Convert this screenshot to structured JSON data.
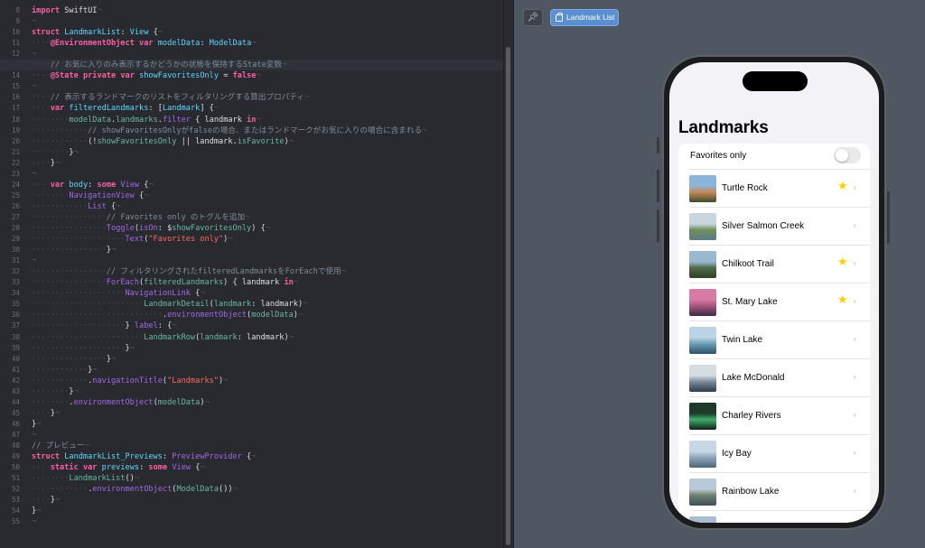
{
  "editor": {
    "current_line": 13,
    "lines": [
      {
        "n": 8,
        "tokens": [
          [
            "kw",
            "import"
          ],
          [
            "pl",
            " SwiftUI"
          ],
          [
            "ws",
            "¬"
          ]
        ]
      },
      {
        "n": 9,
        "tokens": [
          [
            "ws",
            "¬"
          ]
        ]
      },
      {
        "n": 10,
        "tokens": [
          [
            "kw",
            "struct"
          ],
          [
            "pl",
            " "
          ],
          [
            "ty",
            "LandmarkList"
          ],
          [
            "pl",
            ": "
          ],
          [
            "ty",
            "View"
          ],
          [
            "pl",
            " {"
          ],
          [
            "ws",
            "¬"
          ]
        ]
      },
      {
        "n": 11,
        "tokens": [
          [
            "ws",
            "····"
          ],
          [
            "kw",
            "@EnvironmentObject"
          ],
          [
            "pl",
            " "
          ],
          [
            "kw",
            "var"
          ],
          [
            "pl",
            " "
          ],
          [
            "ty",
            "modelData"
          ],
          [
            "pl",
            ": "
          ],
          [
            "ty",
            "ModelData"
          ],
          [
            "ws",
            "¬"
          ]
        ]
      },
      {
        "n": 12,
        "tokens": [
          [
            "ws",
            "¬"
          ]
        ]
      },
      {
        "n": 13,
        "tokens": [
          [
            "ws",
            "····"
          ],
          [
            "cm",
            "// お気に入りのみ表示するかどうかの状態を保持するState変数"
          ],
          [
            "ws",
            "¬"
          ]
        ]
      },
      {
        "n": 14,
        "tokens": [
          [
            "ws",
            "····"
          ],
          [
            "kw",
            "@State"
          ],
          [
            "pl",
            " "
          ],
          [
            "kw",
            "private"
          ],
          [
            "pl",
            " "
          ],
          [
            "kw",
            "var"
          ],
          [
            "pl",
            " "
          ],
          [
            "ty",
            "showFavoritesOnly"
          ],
          [
            "pl",
            " = "
          ],
          [
            "kw",
            "false"
          ],
          [
            "ws",
            "¬"
          ]
        ]
      },
      {
        "n": 15,
        "tokens": [
          [
            "ws",
            "¬"
          ]
        ]
      },
      {
        "n": 16,
        "tokens": [
          [
            "ws",
            "····"
          ],
          [
            "cm",
            "// 表示するランドマークのリストをフィルタリングする算出プロパティ"
          ],
          [
            "ws",
            "¬"
          ]
        ]
      },
      {
        "n": 17,
        "tokens": [
          [
            "ws",
            "····"
          ],
          [
            "kw",
            "var"
          ],
          [
            "pl",
            " "
          ],
          [
            "ty",
            "filteredLandmarks"
          ],
          [
            "pl",
            ": ["
          ],
          [
            "ty",
            "Landmark"
          ],
          [
            "pl",
            "] {"
          ],
          [
            "ws",
            "¬"
          ]
        ]
      },
      {
        "n": 18,
        "tokens": [
          [
            "ws",
            "········"
          ],
          [
            "fn",
            "modelData"
          ],
          [
            "pl",
            "."
          ],
          [
            "fn",
            "landmarks"
          ],
          [
            "pl",
            "."
          ],
          [
            "pr",
            "filter"
          ],
          [
            "pl",
            " { landmark "
          ],
          [
            "kw",
            "in"
          ],
          [
            "ws",
            "¬"
          ]
        ]
      },
      {
        "n": 19,
        "tokens": [
          [
            "ws",
            "············"
          ],
          [
            "cm",
            "// showFavoritesOnlyがfalseの場合、またはランドマークがお気に入りの場合に含まれる"
          ],
          [
            "ws",
            "¬"
          ]
        ]
      },
      {
        "n": 20,
        "tokens": [
          [
            "ws",
            "············"
          ],
          [
            "pl",
            "(!"
          ],
          [
            "fn",
            "showFavoritesOnly"
          ],
          [
            "pl",
            " || landmark."
          ],
          [
            "fn",
            "isFavorite"
          ],
          [
            "pl",
            ")"
          ],
          [
            "ws",
            "¬"
          ]
        ]
      },
      {
        "n": 21,
        "tokens": [
          [
            "ws",
            "········"
          ],
          [
            "pl",
            "}"
          ],
          [
            "ws",
            "¬"
          ]
        ]
      },
      {
        "n": 22,
        "tokens": [
          [
            "ws",
            "····"
          ],
          [
            "pl",
            "}"
          ],
          [
            "ws",
            "¬"
          ]
        ]
      },
      {
        "n": 23,
        "tokens": [
          [
            "ws",
            "¬"
          ]
        ]
      },
      {
        "n": 24,
        "tokens": [
          [
            "ws",
            "····"
          ],
          [
            "kw",
            "var"
          ],
          [
            "pl",
            " "
          ],
          [
            "ty",
            "body"
          ],
          [
            "pl",
            ": "
          ],
          [
            "kw",
            "some"
          ],
          [
            "pl",
            " "
          ],
          [
            "pr",
            "View"
          ],
          [
            "pl",
            " {"
          ],
          [
            "ws",
            "¬"
          ]
        ]
      },
      {
        "n": 25,
        "tokens": [
          [
            "ws",
            "········"
          ],
          [
            "pr",
            "NavigationView"
          ],
          [
            "pl",
            " {"
          ],
          [
            "ws",
            "¬"
          ]
        ]
      },
      {
        "n": 26,
        "tokens": [
          [
            "ws",
            "············"
          ],
          [
            "pr",
            "List"
          ],
          [
            "pl",
            " {"
          ],
          [
            "ws",
            "¬"
          ]
        ]
      },
      {
        "n": 27,
        "tokens": [
          [
            "ws",
            "················"
          ],
          [
            "cm",
            "// Favorites only のトグルを追加"
          ],
          [
            "ws",
            "¬"
          ]
        ]
      },
      {
        "n": 28,
        "tokens": [
          [
            "ws",
            "················"
          ],
          [
            "pr",
            "Toggle"
          ],
          [
            "pl",
            "("
          ],
          [
            "pr",
            "isOn"
          ],
          [
            "pl",
            ": $"
          ],
          [
            "fn",
            "showFavoritesOnly"
          ],
          [
            "pl",
            ") {"
          ],
          [
            "ws",
            "¬"
          ]
        ]
      },
      {
        "n": 29,
        "tokens": [
          [
            "ws",
            "····················"
          ],
          [
            "pr",
            "Text"
          ],
          [
            "pl",
            "("
          ],
          [
            "st",
            "\"Favorites only\""
          ],
          [
            "pl",
            ")"
          ],
          [
            "ws",
            "¬"
          ]
        ]
      },
      {
        "n": 30,
        "tokens": [
          [
            "ws",
            "················"
          ],
          [
            "pl",
            "}"
          ],
          [
            "ws",
            "¬"
          ]
        ]
      },
      {
        "n": 31,
        "tokens": [
          [
            "ws",
            "¬"
          ]
        ]
      },
      {
        "n": 32,
        "tokens": [
          [
            "ws",
            "················"
          ],
          [
            "cm",
            "// フィルタリングされたfilteredLandmarksをForEachで使用"
          ],
          [
            "ws",
            "¬"
          ]
        ]
      },
      {
        "n": 33,
        "tokens": [
          [
            "ws",
            "················"
          ],
          [
            "pr",
            "ForEach"
          ],
          [
            "pl",
            "("
          ],
          [
            "fn",
            "filteredLandmarks"
          ],
          [
            "pl",
            ") { landmark "
          ],
          [
            "kw",
            "in"
          ],
          [
            "ws",
            "¬"
          ]
        ]
      },
      {
        "n": 34,
        "tokens": [
          [
            "ws",
            "····················"
          ],
          [
            "pr",
            "NavigationLink"
          ],
          [
            "pl",
            " {"
          ],
          [
            "ws",
            "¬"
          ]
        ]
      },
      {
        "n": 35,
        "tokens": [
          [
            "ws",
            "························"
          ],
          [
            "fn",
            "LandmarkDetail"
          ],
          [
            "pl",
            "("
          ],
          [
            "fn",
            "landmark"
          ],
          [
            "pl",
            ": landmark)"
          ],
          [
            "ws",
            "¬"
          ]
        ]
      },
      {
        "n": 36,
        "tokens": [
          [
            "ws",
            "····························"
          ],
          [
            "pl",
            "."
          ],
          [
            "pr",
            "environmentObject"
          ],
          [
            "pl",
            "("
          ],
          [
            "fn",
            "modelData"
          ],
          [
            "pl",
            ")"
          ],
          [
            "ws",
            "¬"
          ]
        ]
      },
      {
        "n": 37,
        "tokens": [
          [
            "ws",
            "····················"
          ],
          [
            "pl",
            "} "
          ],
          [
            "pr",
            "label"
          ],
          [
            "pl",
            ": {"
          ],
          [
            "ws",
            "¬"
          ]
        ]
      },
      {
        "n": 38,
        "tokens": [
          [
            "ws",
            "························"
          ],
          [
            "fn",
            "LandmarkRow"
          ],
          [
            "pl",
            "("
          ],
          [
            "fn",
            "landmark"
          ],
          [
            "pl",
            ": landmark)"
          ],
          [
            "ws",
            "¬"
          ]
        ]
      },
      {
        "n": 39,
        "tokens": [
          [
            "ws",
            "····················"
          ],
          [
            "pl",
            "}"
          ],
          [
            "ws",
            "¬"
          ]
        ]
      },
      {
        "n": 40,
        "tokens": [
          [
            "ws",
            "················"
          ],
          [
            "pl",
            "}"
          ],
          [
            "ws",
            "¬"
          ]
        ]
      },
      {
        "n": 41,
        "tokens": [
          [
            "ws",
            "············"
          ],
          [
            "pl",
            "}"
          ],
          [
            "ws",
            "¬"
          ]
        ]
      },
      {
        "n": 42,
        "tokens": [
          [
            "ws",
            "············"
          ],
          [
            "pl",
            "."
          ],
          [
            "pr",
            "navigationTitle"
          ],
          [
            "pl",
            "("
          ],
          [
            "st",
            "\"Landmarks\""
          ],
          [
            "pl",
            ")"
          ],
          [
            "ws",
            "¬"
          ]
        ]
      },
      {
        "n": 43,
        "tokens": [
          [
            "ws",
            "········"
          ],
          [
            "pl",
            "}"
          ],
          [
            "ws",
            "¬"
          ]
        ]
      },
      {
        "n": 44,
        "tokens": [
          [
            "ws",
            "········"
          ],
          [
            "pl",
            "."
          ],
          [
            "pr",
            "environmentObject"
          ],
          [
            "pl",
            "("
          ],
          [
            "fn",
            "modelData"
          ],
          [
            "pl",
            ")"
          ],
          [
            "ws",
            "¬"
          ]
        ]
      },
      {
        "n": 45,
        "tokens": [
          [
            "ws",
            "····"
          ],
          [
            "pl",
            "}"
          ],
          [
            "ws",
            "¬"
          ]
        ]
      },
      {
        "n": 46,
        "tokens": [
          [
            "pl",
            "}"
          ],
          [
            "ws",
            "¬"
          ]
        ]
      },
      {
        "n": 47,
        "tokens": [
          [
            "ws",
            "¬"
          ]
        ]
      },
      {
        "n": 48,
        "tokens": [
          [
            "cm",
            "// プレビュー"
          ],
          [
            "ws",
            "¬"
          ]
        ]
      },
      {
        "n": 49,
        "tokens": [
          [
            "kw",
            "struct"
          ],
          [
            "pl",
            " "
          ],
          [
            "ty",
            "LandmarkList_Previews"
          ],
          [
            "pl",
            ": "
          ],
          [
            "pr",
            "PreviewProvider"
          ],
          [
            "pl",
            " {"
          ],
          [
            "ws",
            "¬"
          ]
        ]
      },
      {
        "n": 50,
        "tokens": [
          [
            "ws",
            "····"
          ],
          [
            "kw",
            "static"
          ],
          [
            "pl",
            " "
          ],
          [
            "kw",
            "var"
          ],
          [
            "pl",
            " "
          ],
          [
            "ty",
            "previews"
          ],
          [
            "pl",
            ": "
          ],
          [
            "kw",
            "some"
          ],
          [
            "pl",
            " "
          ],
          [
            "pr",
            "View"
          ],
          [
            "pl",
            " {"
          ],
          [
            "ws",
            "¬"
          ]
        ]
      },
      {
        "n": 51,
        "tokens": [
          [
            "ws",
            "········"
          ],
          [
            "fn",
            "LandmarkList"
          ],
          [
            "pl",
            "()"
          ],
          [
            "ws",
            "¬"
          ]
        ]
      },
      {
        "n": 52,
        "tokens": [
          [
            "ws",
            "············"
          ],
          [
            "pl",
            "."
          ],
          [
            "pr",
            "environmentObject"
          ],
          [
            "pl",
            "("
          ],
          [
            "fn",
            "ModelData"
          ],
          [
            "pl",
            "())"
          ],
          [
            "ws",
            "¬"
          ]
        ]
      },
      {
        "n": 53,
        "tokens": [
          [
            "ws",
            "····"
          ],
          [
            "pl",
            "}"
          ],
          [
            "ws",
            "¬"
          ]
        ]
      },
      {
        "n": 54,
        "tokens": [
          [
            "pl",
            "}"
          ],
          [
            "ws",
            "¬"
          ]
        ]
      },
      {
        "n": 55,
        "tokens": [
          [
            "ws",
            "¬"
          ]
        ]
      }
    ]
  },
  "canvas": {
    "pin_icon": "pin-icon",
    "preview_chip_label": "Landmark List"
  },
  "app": {
    "nav_title": "Landmarks",
    "favorites_toggle": {
      "label": "Favorites only",
      "on": false
    },
    "landmarks": [
      {
        "name": "Turtle Rock",
        "favorite": true,
        "thumb": [
          "#8cb4d8",
          "#c98a5a",
          "#3f4b2c"
        ]
      },
      {
        "name": "Silver Salmon Creek",
        "favorite": false,
        "thumb": [
          "#c9d6df",
          "#6f8f5a",
          "#5b7a8a"
        ]
      },
      {
        "name": "Chilkoot Trail",
        "favorite": true,
        "thumb": [
          "#9ab8d0",
          "#4f6b4a",
          "#2f3f2a"
        ]
      },
      {
        "name": "St. Mary Lake",
        "favorite": true,
        "thumb": [
          "#d97aa6",
          "#a9577f",
          "#3b2a45"
        ]
      },
      {
        "name": "Twin Lake",
        "favorite": false,
        "thumb": [
          "#bcd3e6",
          "#6b9fb8",
          "#2e4f66"
        ]
      },
      {
        "name": "Lake McDonald",
        "favorite": false,
        "thumb": [
          "#d5dde3",
          "#7d8c9a",
          "#2d3c4a"
        ]
      },
      {
        "name": "Charley Rivers",
        "favorite": false,
        "thumb": [
          "#1d3a2a",
          "#3fae6a",
          "#0f1f18"
        ]
      },
      {
        "name": "Icy Bay",
        "favorite": false,
        "thumb": [
          "#c7d7e6",
          "#8ea6bb",
          "#4d6479"
        ]
      },
      {
        "name": "Rainbow Lake",
        "favorite": false,
        "thumb": [
          "#b8c9d9",
          "#6f7f6a",
          "#3c4f5f"
        ]
      },
      {
        "name": "",
        "favorite": false,
        "thumb": [
          "#a9bcd0",
          "#6d7d8d",
          "#3a4a5a"
        ]
      }
    ]
  }
}
